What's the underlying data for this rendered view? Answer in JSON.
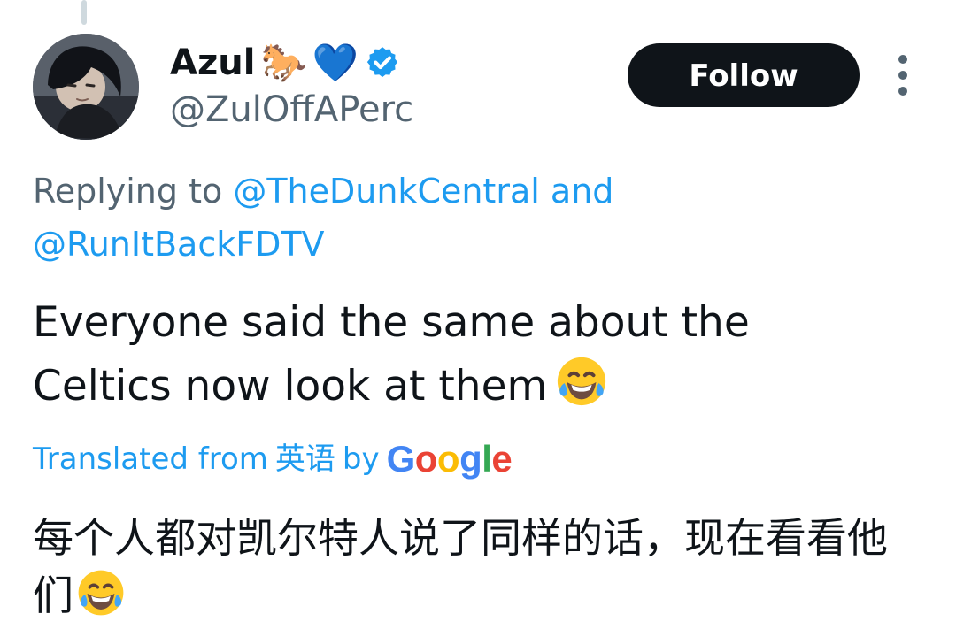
{
  "tweet": {
    "author": {
      "display_name": "Azul",
      "name_emojis": [
        "🐎",
        "💙"
      ],
      "handle": "@ZulOffAPerc",
      "verified": true
    },
    "follow_button": "Follow",
    "reply_context": {
      "prefix": "Replying to",
      "mention_1": "@TheDunkCentral",
      "connector": "and",
      "mention_2": "@RunItBackFDTV"
    },
    "text": "Everyone said the same about the Celtics now look at them",
    "text_emoji": "😂",
    "translation": {
      "label_prefix": "Translated from",
      "source_language": "英语",
      "label_by": "by",
      "provider_letters": [
        "G",
        "o",
        "o",
        "g",
        "l",
        "e"
      ],
      "translated_text": "每个人都对凯尔特人说了同样的话，现在看看他们",
      "translated_emoji": "😂"
    }
  },
  "icons": {
    "verified": "verified-badge-icon",
    "more": "more-vertical-icon",
    "horse": "horse-emoji",
    "blue_heart": "blue-heart-emoji",
    "laughing": "face-with-tears-of-joy-emoji"
  },
  "colors": {
    "text_primary": "#0f1419",
    "text_secondary": "#536471",
    "link": "#1d9bf0",
    "follow_bg": "#0f1419",
    "follow_text": "#ffffff",
    "thread_line": "#cfd9de",
    "google_blue": "#4285f4",
    "google_red": "#ea4335",
    "google_yellow": "#fbbc05",
    "google_green": "#34a853"
  }
}
